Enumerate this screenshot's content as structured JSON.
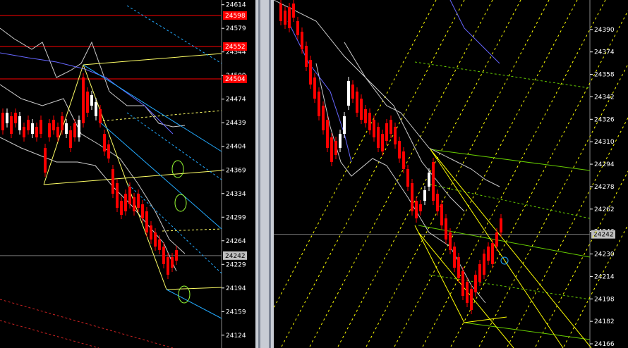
{
  "left_chart": {
    "y_range": [
      24105,
      24621
    ],
    "axis_ticks": [
      "24614",
      "24579",
      "24544",
      "24509",
      "24474",
      "24439",
      "24404",
      "24369",
      "24334",
      "24299",
      "24264",
      "24229",
      "24194",
      "24159",
      "24124"
    ],
    "current_price": "24242",
    "level_tags": [
      {
        "label": "24598",
        "value": 24598
      },
      {
        "label": "24552",
        "value": 24552
      },
      {
        "label": "24504",
        "value": 24504
      }
    ],
    "colors": {
      "bull": "#ffffff",
      "bear": "#ff0000",
      "level": "#ff0000",
      "channel": "#ffff66",
      "cyan": "#22aaff",
      "band": "#cccccc",
      "ma": "#6666ff",
      "circle": "#99ff33"
    }
  },
  "right_chart": {
    "y_range": [
      24163,
      24411
    ],
    "axis_ticks": [
      "24390",
      "24374",
      "24358",
      "24342",
      "24326",
      "24310",
      "24294",
      "24278",
      "24262",
      "24246",
      "24230",
      "24214",
      "24198",
      "24182",
      "24166"
    ],
    "current_price": "24242",
    "colors": {
      "bull": "#ffffff",
      "bear": "#ff0000",
      "fan": "#ffff00",
      "green": "#66cc00",
      "band": "#cccccc",
      "ma": "#6666ff",
      "cyan": "#22aaff"
    }
  }
}
